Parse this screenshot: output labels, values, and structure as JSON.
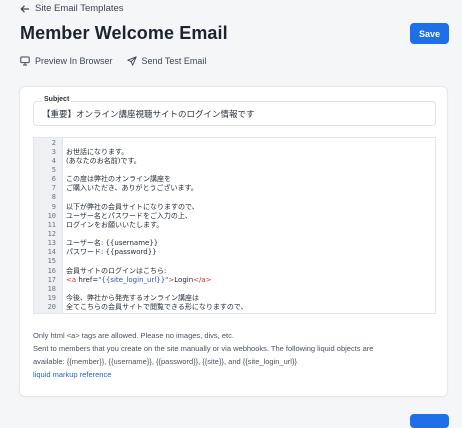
{
  "nav": {
    "back_label": "Site Email Templates"
  },
  "header": {
    "title": "Member Welcome Email",
    "save_label": "Save"
  },
  "actions": {
    "preview_label": "Preview In Browser",
    "send_test_label": "Send Test Email"
  },
  "subject": {
    "label": "Subject",
    "value": "【重要】オンライン講座視聴サイトのログイン情報です"
  },
  "editor": {
    "lines": [
      {
        "num": "2",
        "text": ""
      },
      {
        "num": "3",
        "text": "お世話になります。"
      },
      {
        "num": "4",
        "text": "(あなたのお名前)です。"
      },
      {
        "num": "5",
        "text": ""
      },
      {
        "num": "6",
        "text": "この度は弊社のオンライン講座を"
      },
      {
        "num": "7",
        "text": "ご購入いただき、ありがとうございます。"
      },
      {
        "num": "8",
        "text": ""
      },
      {
        "num": "9",
        "text": "以下が弊社の会員サイトになりますので、"
      },
      {
        "num": "10",
        "text": "ユーザー名とパスワードをご入力の上、"
      },
      {
        "num": "11",
        "text": "ログインをお願いいたします。"
      },
      {
        "num": "12",
        "text": ""
      },
      {
        "num": "13",
        "text": "ユーザー名: {{username}}"
      },
      {
        "num": "14",
        "text": "パスワード: {{password}}"
      },
      {
        "num": "15",
        "text": ""
      },
      {
        "num": "16",
        "text": "会員サイトのログインはこちら:"
      },
      {
        "num": "17",
        "text": "<a href=\"{{site_login_url}}\">Login</a>"
      },
      {
        "num": "18",
        "text": ""
      },
      {
        "num": "19",
        "text": "今後、弊社から発売するオンライン講座は"
      },
      {
        "num": "20",
        "text": "全てこちらの会員サイトで閲覧できる形になりますので、"
      }
    ]
  },
  "help": {
    "line1": "Only html <a> tags are allowed. Please no images, divs, etc.",
    "line2": "Sent to members that you create on the site manually or via webhooks. The following liquid objects are",
    "line3": "available: {{member}}, {{username}}, {{password}}, {{site}}, and {{site_login_url}}",
    "link": "liquid markup reference"
  },
  "colors": {
    "accent": "#1f6fe8",
    "link": "#2563c9",
    "tag": "#c0392b"
  }
}
